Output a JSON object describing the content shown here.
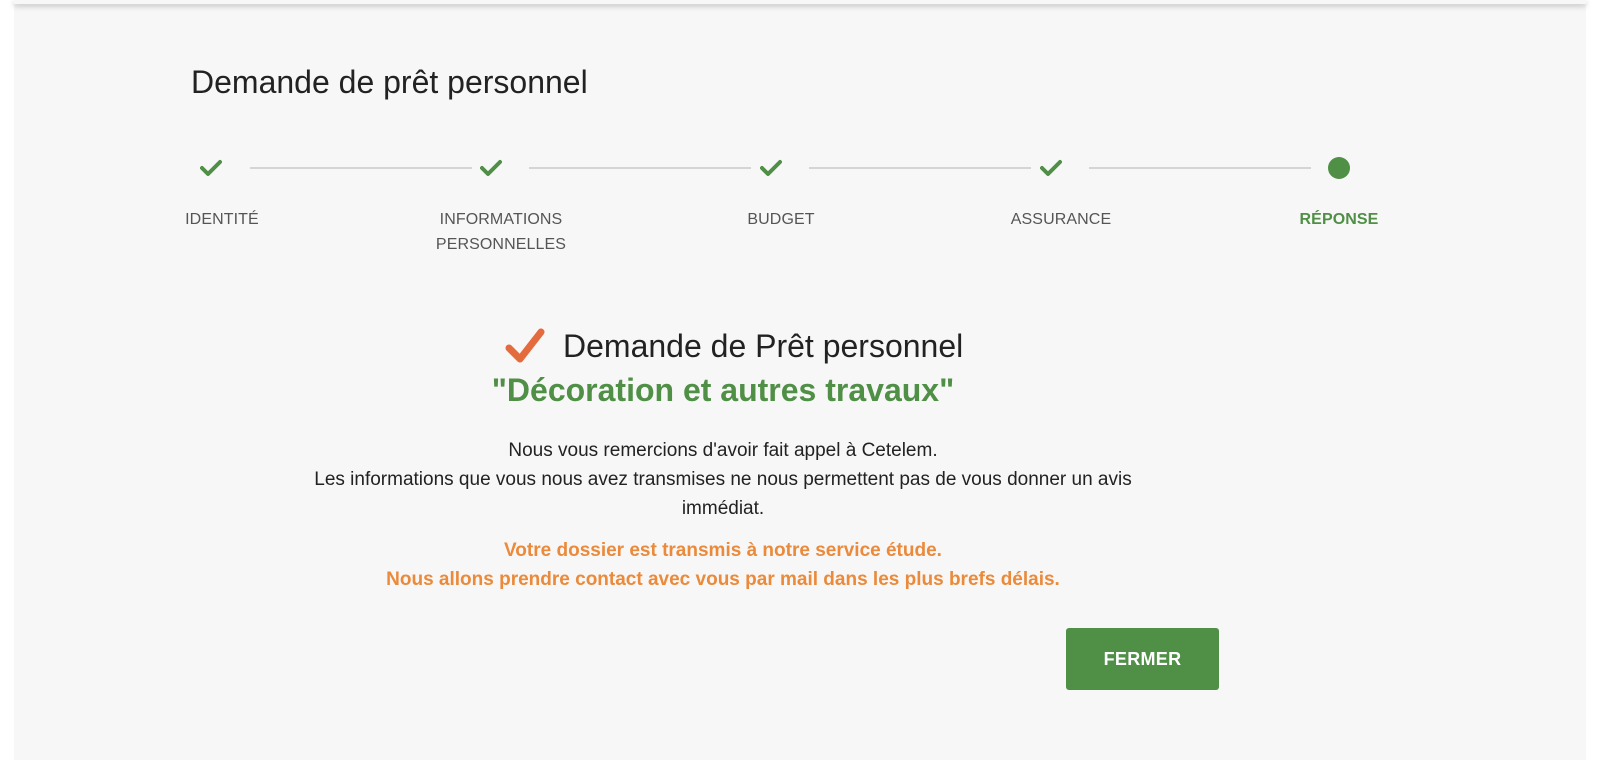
{
  "page": {
    "title": "Demande de prêt personnel"
  },
  "stepper": {
    "steps": [
      {
        "label": "IDENTITÉ",
        "status": "completed",
        "icon": "check-icon"
      },
      {
        "label": "INFORMATIONS PERSONNELLES",
        "status": "completed",
        "icon": "check-icon"
      },
      {
        "label": "BUDGET",
        "status": "completed",
        "icon": "check-icon"
      },
      {
        "label": "ASSURANCE",
        "status": "completed",
        "icon": "check-icon"
      },
      {
        "label": "RÉPONSE",
        "status": "current",
        "icon": "dot-icon"
      }
    ]
  },
  "result": {
    "icon": "check-icon",
    "title": "Demande de Prêt personnel",
    "subtitle": "\"Décoration et autres travaux\"",
    "message_line1": "Nous vous remercions d'avoir fait appel à Cetelem.",
    "message_line2": "Les informations que vous nous avez transmises ne nous permettent pas de vous donner un avis immédiat.",
    "note_line1": "Votre dossier est transmis à notre service étude.",
    "note_line2": "Nous allons prendre contact avec vous par mail dans les plus brefs délais."
  },
  "actions": {
    "close_label": "FERMER"
  },
  "colors": {
    "accent_green": "#4f8f46",
    "orange": "#ea8a3a",
    "check_orange": "#e36b3d",
    "panel_bg": "#f7f7f7"
  }
}
